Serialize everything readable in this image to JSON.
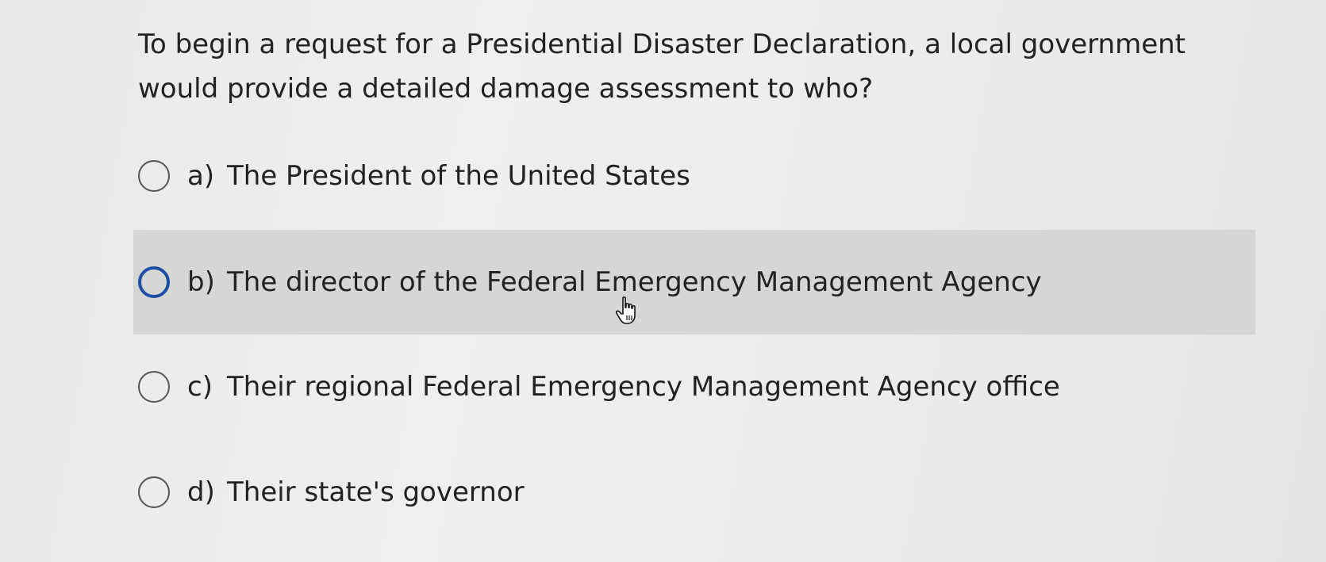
{
  "question": {
    "text": "To begin a request for a Presidential Disaster Declaration, a local government would provide a detailed damage assessment to who?"
  },
  "options": [
    {
      "letter": "a)",
      "text": "The President of the United States",
      "state": "default"
    },
    {
      "letter": "b)",
      "text": "The director of the Federal Emergency Management Agency",
      "state": "hover"
    },
    {
      "letter": "c)",
      "text": "Their regional Federal Emergency Management Agency office",
      "state": "default"
    },
    {
      "letter": "d)",
      "text": "Their state's governor",
      "state": "default"
    }
  ],
  "colors": {
    "hover_background": "#d6d6d4",
    "hover_radio_border": "#1d4fa8",
    "radio_border": "#555555",
    "text": "#222222"
  },
  "icons": {
    "cursor": "hand-pointer-icon"
  }
}
